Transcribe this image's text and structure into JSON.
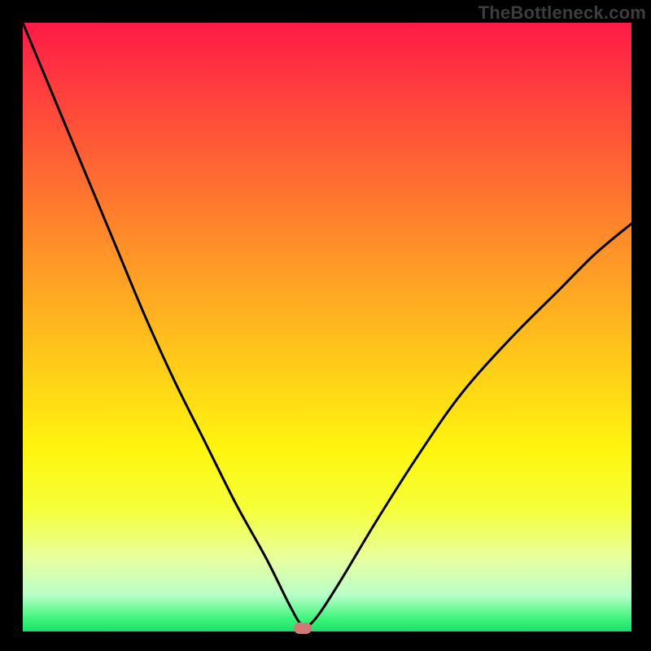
{
  "watermark": "TheBottleneck.com",
  "chart_data": {
    "type": "line",
    "title": "",
    "xlabel": "",
    "ylabel": "",
    "x": [
      0.0,
      0.05,
      0.1,
      0.15,
      0.2,
      0.25,
      0.3,
      0.35,
      0.4,
      0.44,
      0.46,
      0.48,
      0.52,
      0.58,
      0.65,
      0.72,
      0.8,
      0.88,
      0.94,
      1.0
    ],
    "values": [
      100,
      88,
      76,
      64,
      52,
      41,
      31,
      21,
      12,
      4,
      1,
      2,
      8,
      18,
      29,
      39,
      48,
      56,
      62,
      67
    ],
    "xlim": [
      0,
      1
    ],
    "ylim": [
      0,
      100
    ],
    "legend": false,
    "grid": false,
    "background_gradient": {
      "from": "#ff1a47",
      "to": "#17e06a",
      "direction": "vertical"
    },
    "marker": {
      "x": 0.46,
      "y": 0.5,
      "color": "#cf7a76"
    }
  },
  "colors": {
    "curve": "#000000",
    "frame": "#000000",
    "marker": "#cf7a76",
    "watermark": "#3d3d3d"
  }
}
